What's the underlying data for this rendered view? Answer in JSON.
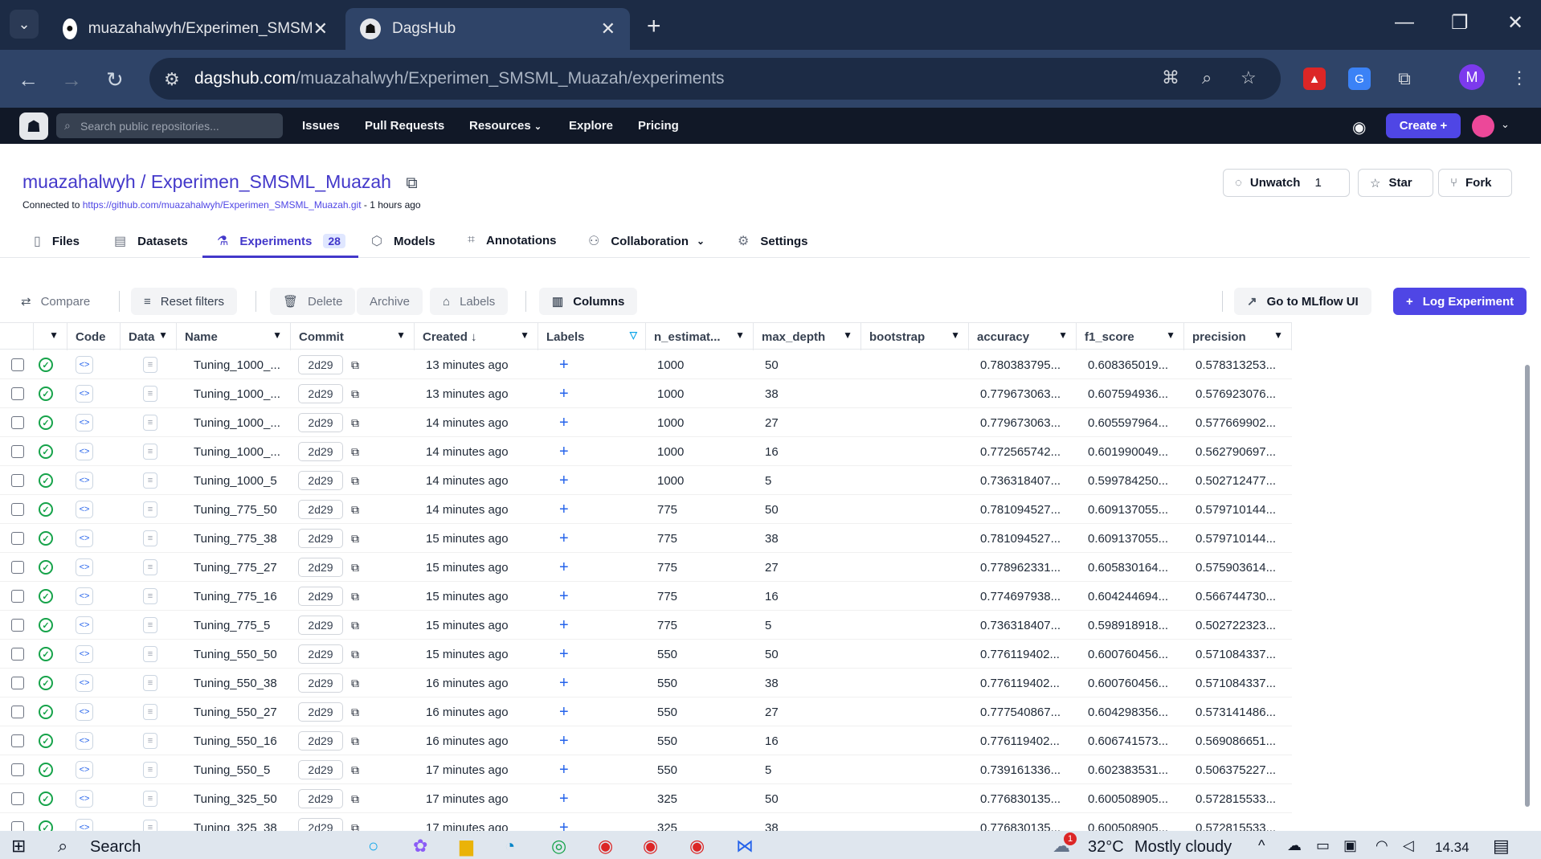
{
  "browser": {
    "tabs": [
      {
        "title": "muazahalwyh/Experimen_SMSM",
        "icon": "github-icon"
      },
      {
        "title": "DagsHub",
        "icon": "dagshub-icon"
      }
    ],
    "url_host": "dagshub.com",
    "url_path": "/muazahalwyh/Experimen_SMSML_Muazah/experiments",
    "profile_initial": "M"
  },
  "nav": {
    "search_placeholder": "Search public repositories...",
    "links": [
      "Issues",
      "Pull Requests",
      "Resources",
      "Explore",
      "Pricing"
    ],
    "create_label": "Create +"
  },
  "repo": {
    "owner": "muazahalwyh",
    "separator": " / ",
    "name": "Experimen_SMSML_Muazah",
    "connected_prefix": "Connected to ",
    "connected_url": "https://github.com/muazahalwyh/Experimen_SMSML_Muazah.git",
    "connected_suffix": " - 1 hours ago",
    "unwatch_label": "Unwatch",
    "unwatch_count": "1",
    "star_label": "Star",
    "fork_label": "Fork"
  },
  "tabs": {
    "files": "Files",
    "datasets": "Datasets",
    "experiments": "Experiments",
    "experiments_count": "28",
    "models": "Models",
    "annotations": "Annotations",
    "collaboration": "Collaboration",
    "settings": "Settings"
  },
  "toolbar": {
    "compare": "Compare",
    "reset_filters": "Reset filters",
    "delete": "Delete",
    "archive": "Archive",
    "labels": "Labels",
    "columns": "Columns",
    "mlflow": "Go to MLflow UI",
    "log_experiment": "Log Experiment"
  },
  "table": {
    "headers": {
      "code": "Code",
      "data": "Data",
      "name": "Name",
      "commit": "Commit",
      "created": "Created ↓",
      "labels": "Labels",
      "n_estimators": "n_estimat...",
      "max_depth": "max_depth",
      "bootstrap": "bootstrap",
      "accuracy": "accuracy",
      "f1_score": "f1_score",
      "precision": "precision"
    },
    "rows": [
      {
        "name": "Tuning_1000_...",
        "commit": "2d29",
        "created": "13 minutes ago",
        "n_est": "1000",
        "max_depth": "50",
        "accuracy": "0.780383795...",
        "f1": "0.608365019...",
        "precision": "0.578313253..."
      },
      {
        "name": "Tuning_1000_...",
        "commit": "2d29",
        "created": "13 minutes ago",
        "n_est": "1000",
        "max_depth": "38",
        "accuracy": "0.779673063...",
        "f1": "0.607594936...",
        "precision": "0.576923076..."
      },
      {
        "name": "Tuning_1000_...",
        "commit": "2d29",
        "created": "14 minutes ago",
        "n_est": "1000",
        "max_depth": "27",
        "accuracy": "0.779673063...",
        "f1": "0.605597964...",
        "precision": "0.577669902..."
      },
      {
        "name": "Tuning_1000_...",
        "commit": "2d29",
        "created": "14 minutes ago",
        "n_est": "1000",
        "max_depth": "16",
        "accuracy": "0.772565742...",
        "f1": "0.601990049...",
        "precision": "0.562790697..."
      },
      {
        "name": "Tuning_1000_5",
        "commit": "2d29",
        "created": "14 minutes ago",
        "n_est": "1000",
        "max_depth": "5",
        "accuracy": "0.736318407...",
        "f1": "0.599784250...",
        "precision": "0.502712477..."
      },
      {
        "name": "Tuning_775_50",
        "commit": "2d29",
        "created": "14 minutes ago",
        "n_est": "775",
        "max_depth": "50",
        "accuracy": "0.781094527...",
        "f1": "0.609137055...",
        "precision": "0.579710144..."
      },
      {
        "name": "Tuning_775_38",
        "commit": "2d29",
        "created": "15 minutes ago",
        "n_est": "775",
        "max_depth": "38",
        "accuracy": "0.781094527...",
        "f1": "0.609137055...",
        "precision": "0.579710144..."
      },
      {
        "name": "Tuning_775_27",
        "commit": "2d29",
        "created": "15 minutes ago",
        "n_est": "775",
        "max_depth": "27",
        "accuracy": "0.778962331...",
        "f1": "0.605830164...",
        "precision": "0.575903614..."
      },
      {
        "name": "Tuning_775_16",
        "commit": "2d29",
        "created": "15 minutes ago",
        "n_est": "775",
        "max_depth": "16",
        "accuracy": "0.774697938...",
        "f1": "0.604244694...",
        "precision": "0.566744730..."
      },
      {
        "name": "Tuning_775_5",
        "commit": "2d29",
        "created": "15 minutes ago",
        "n_est": "775",
        "max_depth": "5",
        "accuracy": "0.736318407...",
        "f1": "0.598918918...",
        "precision": "0.502722323..."
      },
      {
        "name": "Tuning_550_50",
        "commit": "2d29",
        "created": "15 minutes ago",
        "n_est": "550",
        "max_depth": "50",
        "accuracy": "0.776119402...",
        "f1": "0.600760456...",
        "precision": "0.571084337..."
      },
      {
        "name": "Tuning_550_38",
        "commit": "2d29",
        "created": "16 minutes ago",
        "n_est": "550",
        "max_depth": "38",
        "accuracy": "0.776119402...",
        "f1": "0.600760456...",
        "precision": "0.571084337..."
      },
      {
        "name": "Tuning_550_27",
        "commit": "2d29",
        "created": "16 minutes ago",
        "n_est": "550",
        "max_depth": "27",
        "accuracy": "0.777540867...",
        "f1": "0.604298356...",
        "precision": "0.573141486..."
      },
      {
        "name": "Tuning_550_16",
        "commit": "2d29",
        "created": "16 minutes ago",
        "n_est": "550",
        "max_depth": "16",
        "accuracy": "0.776119402...",
        "f1": "0.606741573...",
        "precision": "0.569086651..."
      },
      {
        "name": "Tuning_550_5",
        "commit": "2d29",
        "created": "17 minutes ago",
        "n_est": "550",
        "max_depth": "5",
        "accuracy": "0.739161336...",
        "f1": "0.602383531...",
        "precision": "0.506375227..."
      },
      {
        "name": "Tuning_325_50",
        "commit": "2d29",
        "created": "17 minutes ago",
        "n_est": "325",
        "max_depth": "50",
        "accuracy": "0.776830135...",
        "f1": "0.600508905...",
        "precision": "0.572815533..."
      },
      {
        "name": "Tuning_325_38",
        "commit": "2d29",
        "created": "17 minutes ago",
        "n_est": "325",
        "max_depth": "38",
        "accuracy": "0.776830135...",
        "f1": "0.600508905...",
        "precision": "0.572815533..."
      }
    ]
  },
  "taskbar": {
    "search": "Search",
    "weather_temp": "32°C",
    "weather_text": "Mostly cloudy",
    "time": "14.34",
    "notification_count": "1"
  }
}
